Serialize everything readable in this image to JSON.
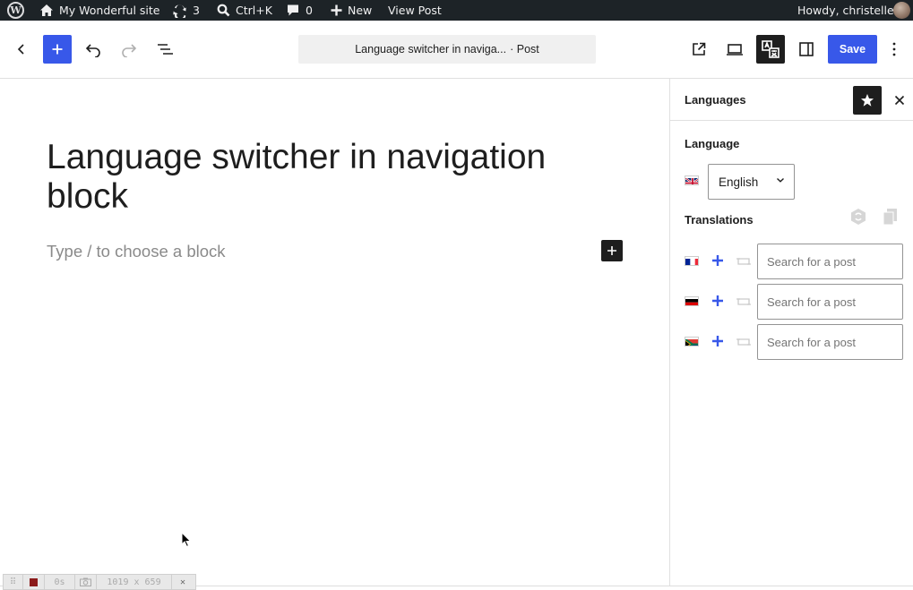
{
  "admin_bar": {
    "site_name": "My Wonderful site",
    "updates_count": "3",
    "search_shortcut": "Ctrl+K",
    "comments_count": "0",
    "new_label": "New",
    "view_post_label": "View Post",
    "greeting": "Howdy, christelle"
  },
  "editor_header": {
    "document_title": "Language switcher in naviga...",
    "document_type": "· Post",
    "save_label": "Save"
  },
  "canvas": {
    "post_title": "Language switcher in navigation block",
    "block_placeholder": "Type / to choose a block"
  },
  "sidebar": {
    "panel_title": "Languages",
    "language_section_label": "Language",
    "current_language": "English",
    "translations_section_label": "Translations",
    "translations": [
      {
        "flag": "french-flag-icon",
        "search_placeholder": "Search for a post"
      },
      {
        "flag": "german-flag-icon",
        "search_placeholder": "Search for a post"
      },
      {
        "flag": "south-african-flag-icon",
        "search_placeholder": "Search for a post"
      }
    ]
  },
  "dev_toolbar": {
    "timer": "0s",
    "dimensions": "1019 x 659"
  },
  "colors": {
    "admin_bar_bg": "#1d2327",
    "accent": "#3858e9",
    "text": "#1e1e1e",
    "placeholder": "#8a8a8a"
  }
}
